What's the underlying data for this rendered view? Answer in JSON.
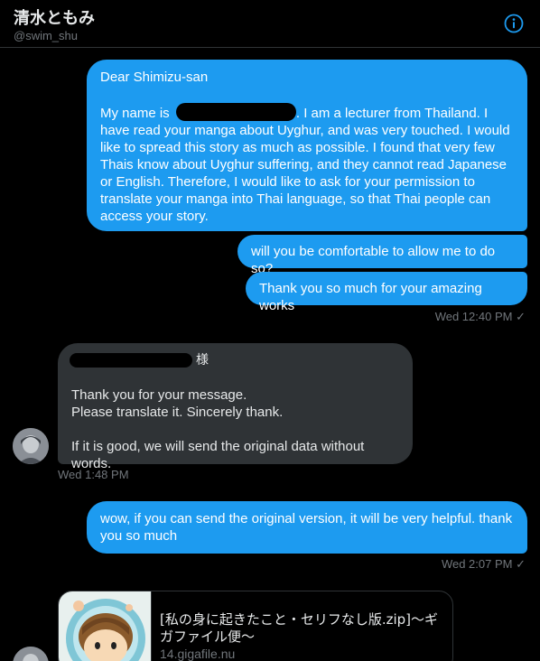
{
  "header": {
    "name": "清水ともみ",
    "handle": "@swim_shu",
    "colors": {
      "accent": "#1d9bf0",
      "background": "#000000"
    },
    "info_icon": "info-circle-icon"
  },
  "messages": [
    {
      "direction": "outgoing",
      "greeting": "Dear Shimizu-san",
      "body_prefix": "My name is",
      "body_rest": ". I am a lecturer from Thailand. I have read your manga about Uyghur, and was very touched. I would like to spread this story as much as possible. I found that very few Thais know about Uyghur suffering, and they cannot read Japanese or English. Therefore, I would like to ask for your permission to translate your manga into Thai language, so that Thai people can access your story."
    },
    {
      "direction": "outgoing",
      "text": "will you be comfortable to allow me to do so?"
    },
    {
      "direction": "outgoing",
      "text": "Thank you so much for your amazing works",
      "time": "Wed 12:40 PM",
      "status": "✓"
    },
    {
      "direction": "incoming",
      "salutation_suffix": "様",
      "line1": "Thank you for your message.",
      "line2": "Please translate it. Sincerely thank.",
      "line3": "If it is good, we will send the original data without words.",
      "time": "Wed 1:48 PM"
    },
    {
      "direction": "outgoing",
      "text": "wow, if you can send the original version, it will be very helpful. thank you so much",
      "time": "Wed 2:07 PM",
      "status": "✓"
    }
  ],
  "link_card": {
    "title": "[私の身に起きたこと・セリフなし版.zip]～ギガファイル便～",
    "domain": "14.gigafile.nu"
  }
}
